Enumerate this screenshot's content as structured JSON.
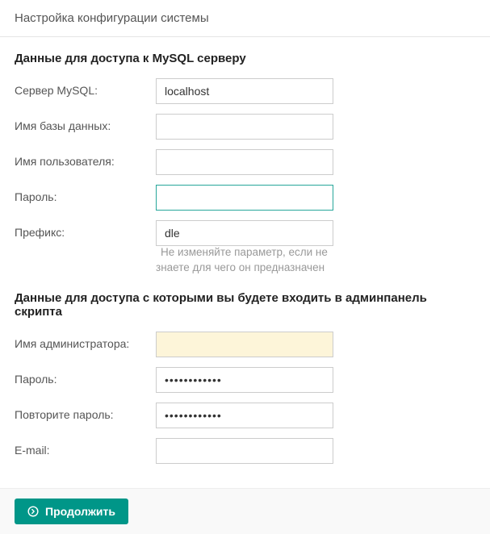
{
  "header": {
    "title": "Настройка конфигурации системы"
  },
  "mysql_section": {
    "title": "Данные для доступа к MySQL серверу",
    "server": {
      "label": "Сервер MySQL:",
      "value": "localhost"
    },
    "dbname": {
      "label": "Имя базы данных:",
      "value": ""
    },
    "username": {
      "label": "Имя пользователя:",
      "value": ""
    },
    "password": {
      "label": "Пароль:",
      "value": ""
    },
    "prefix": {
      "label": "Префикс:",
      "value": "dle",
      "hint1": "Не изменяйте параметр, если не",
      "hint2": "знаете для чего он предназначен"
    }
  },
  "admin_section": {
    "title": "Данные для доступа с которыми вы будете входить в админпанель скрипта",
    "admin_name": {
      "label": "Имя администратора:",
      "value": ""
    },
    "password": {
      "label": "Пароль:",
      "value": "************"
    },
    "password_repeat": {
      "label": "Повторите пароль:",
      "value": "************"
    },
    "email": {
      "label": "E-mail:",
      "value": ""
    }
  },
  "footer": {
    "continue_label": "Продолжить"
  }
}
